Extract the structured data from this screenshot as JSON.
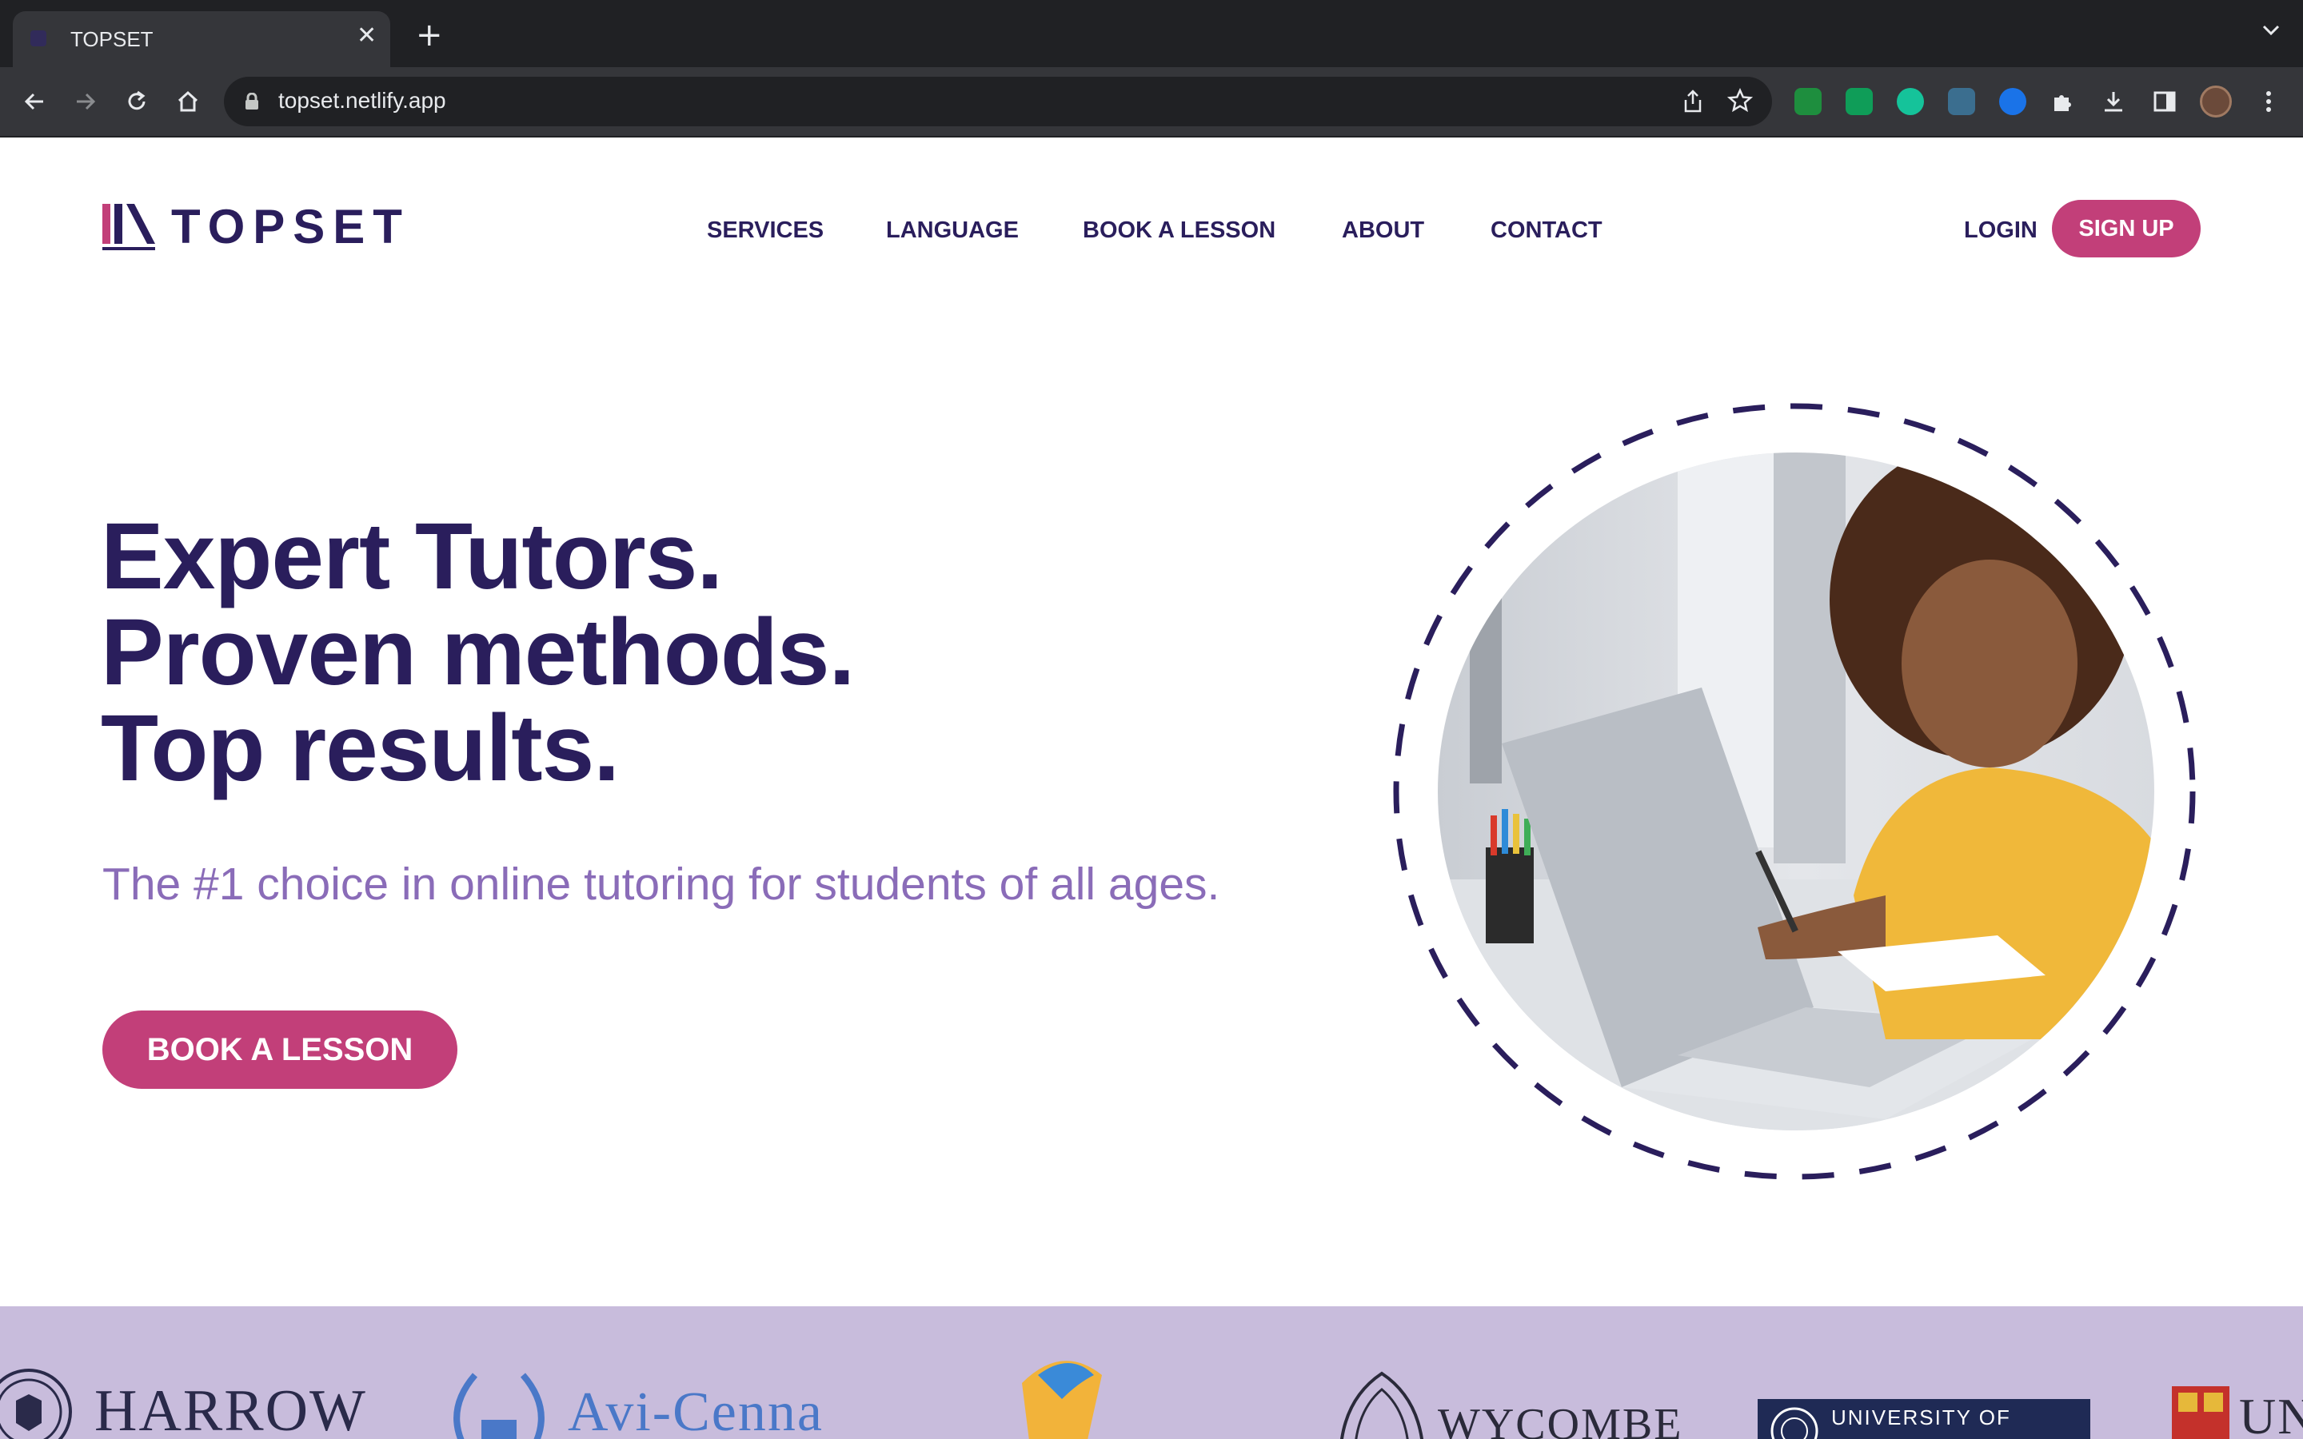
{
  "browser": {
    "tab_title": "TOPSET",
    "tab_close": "✕",
    "new_tab": "+",
    "url": "topset.netlify.app",
    "extension_colors": [
      "#1e8e3e",
      "#0f9d58",
      "#15c39a",
      "#3b6e8f",
      "#1a73e8"
    ]
  },
  "header": {
    "logo_text": "TOPSET",
    "nav": [
      "SERVICES",
      "LANGUAGE",
      "BOOK A LESSON",
      "ABOUT",
      "CONTACT"
    ],
    "login": "LOGIN",
    "signup": "SIGN UP"
  },
  "hero": {
    "title_lines": [
      "Expert Tutors.",
      "Proven methods.",
      "Top results."
    ],
    "subtitle": "The #1 choice in online tutoring for students of all ages.",
    "cta": "BOOK A LESSON"
  },
  "logos_band": {
    "schools": [
      "HARROW",
      "Avi-Cenna",
      "WYCOMBE",
      "UNIVERSITY OF",
      "UNI"
    ]
  },
  "colors": {
    "brand_navy": "#2a1e5c",
    "brand_pink": "#c23f79",
    "subtitle_purple": "#8a6cb8",
    "band_lavender": "#c8bcdc"
  }
}
